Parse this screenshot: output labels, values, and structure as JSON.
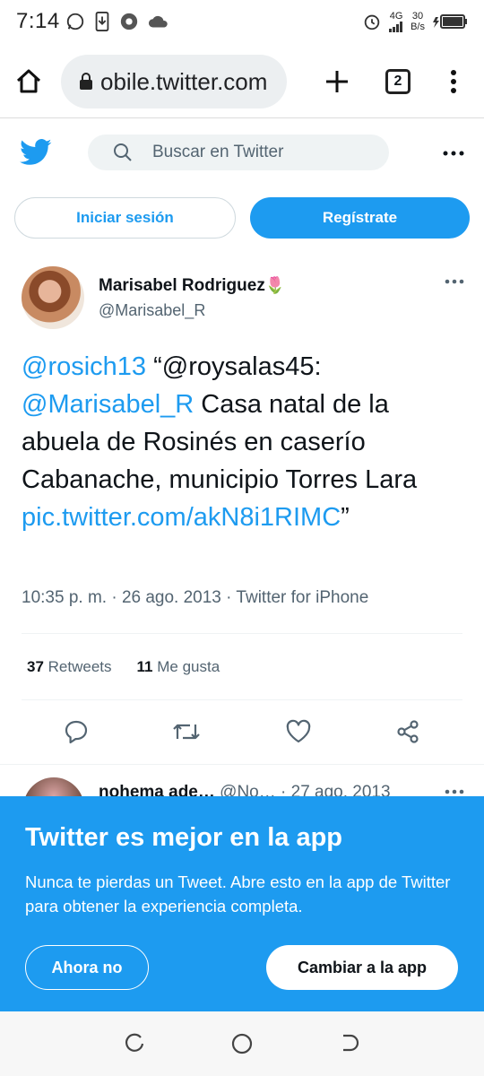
{
  "status_bar": {
    "time": "7:14",
    "network": "4G",
    "speed_value": "30",
    "speed_unit": "B/s"
  },
  "browser": {
    "url": "obile.twitter.com",
    "tab_count": "2"
  },
  "twitter_header": {
    "search_placeholder": "Buscar en Twitter"
  },
  "auth": {
    "login_label": "Iniciar sesión",
    "signup_label": "Regístrate"
  },
  "tweet": {
    "display_name": "Marisabel Rodriguez",
    "name_emoji": "🌷",
    "handle": "@Marisabel_R",
    "text": {
      "mention1": "@rosich13",
      "quote_open": " “@roysalas45: ",
      "mention2": "@Marisabel_R",
      "body": " Casa natal de la abuela de Rosinés en  caserío Cabanache, municipio Torres Lara ",
      "link": "pic.twitter.com/akN8i1RIMC",
      "quote_close": "”"
    },
    "meta": "10:35 p. m. · 26 ago. 2013 · Twitter for iPhone",
    "retweets_count": "37",
    "retweets_label": "Retweets",
    "likes_count": "11",
    "likes_label": "Me gusta"
  },
  "reply_peek": {
    "name": "nohema ade…",
    "handle": "@No…",
    "date": "· 27 ago. 2013"
  },
  "app_banner": {
    "title": "Twitter es mejor en la app",
    "description": "Nunca te pierdas un Tweet. Abre esto en la app de Twitter para obtener la experiencia completa.",
    "dismiss_label": "Ahora no",
    "open_label": "Cambiar a la app"
  },
  "colors": {
    "twitter_blue": "#1d9bf0",
    "text_primary": "#0f1419",
    "text_secondary": "#536471"
  }
}
